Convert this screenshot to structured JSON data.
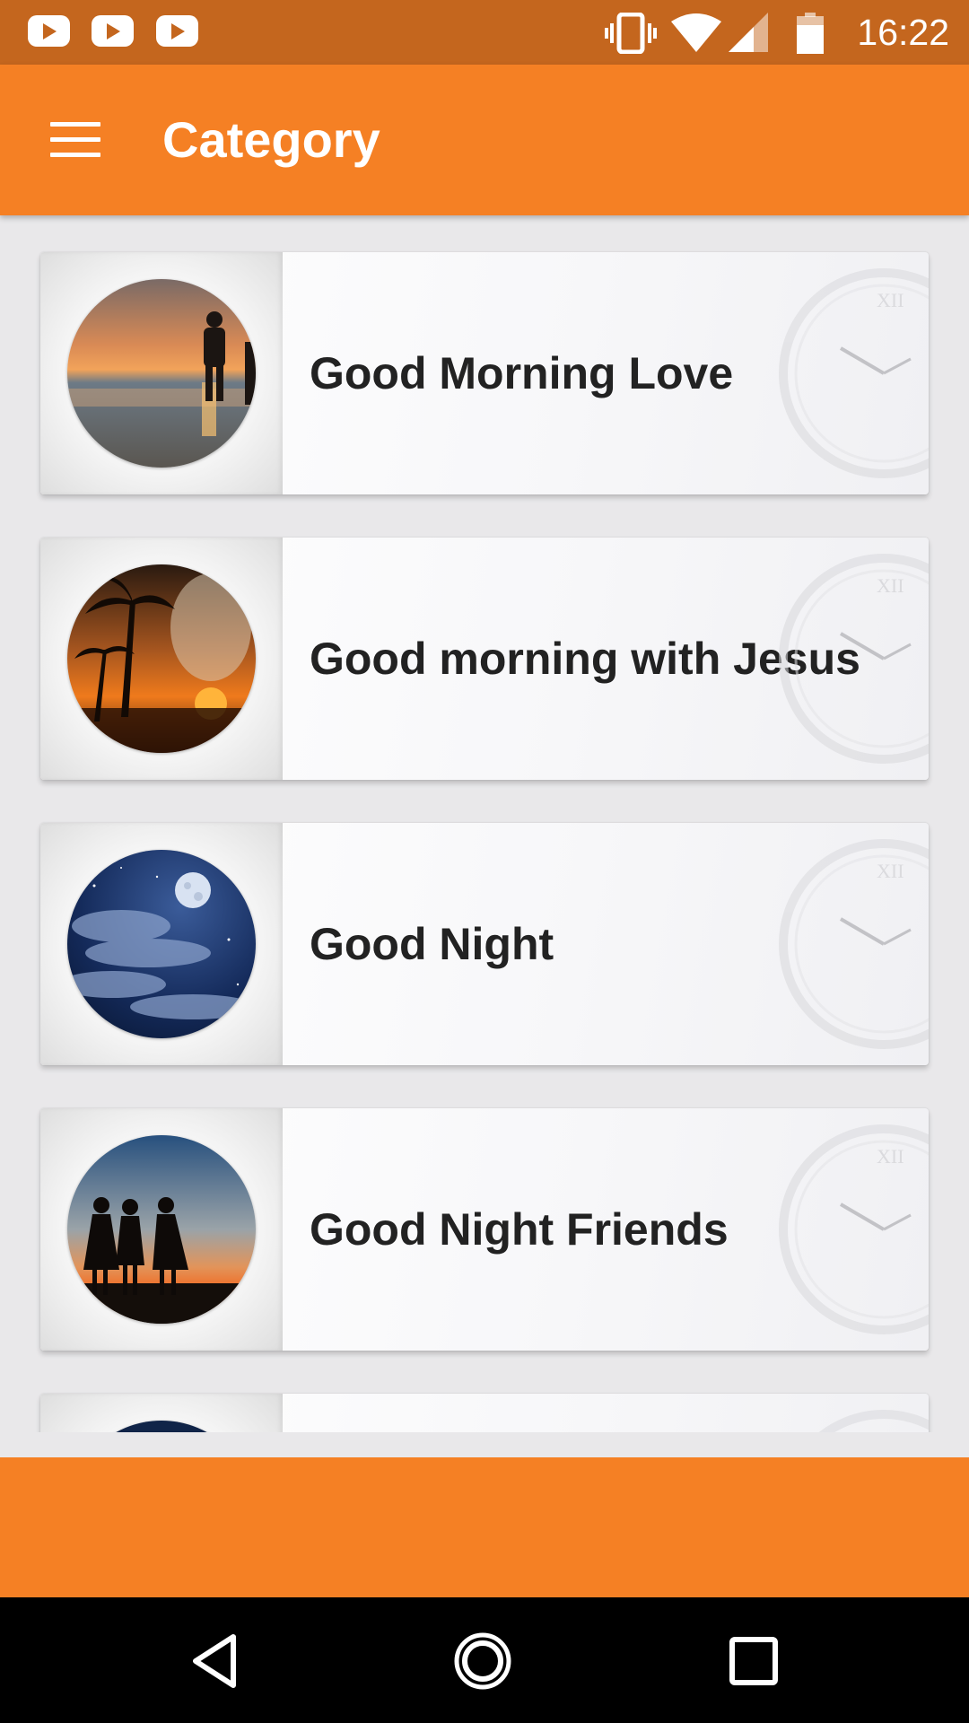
{
  "status_bar": {
    "time": "16:22",
    "notification_icons": [
      "youtube-icon",
      "youtube-icon",
      "youtube-icon"
    ],
    "system_icons": [
      "vibrate-icon",
      "wifi-icon",
      "signal-icon",
      "battery-icon"
    ]
  },
  "app_bar": {
    "menu_icon": "hamburger-menu-icon",
    "title": "Category"
  },
  "categories": [
    {
      "label": "Good Morning Love",
      "image": "couple-beach-sunset"
    },
    {
      "label": "Good morning with Jesus",
      "image": "palm-trees-sunset-jesus"
    },
    {
      "label": "Good Night",
      "image": "night-sky-moon-clouds"
    },
    {
      "label": "Good Night Friends",
      "image": "friends-silhouette-sunset"
    },
    {
      "label": "",
      "image": "night-sky-partial"
    }
  ],
  "nav_bar": {
    "back": "back-icon",
    "home": "home-icon",
    "recents": "recents-icon"
  },
  "colors": {
    "status_bar": "#c4661e",
    "app_bar": "#f58024",
    "background": "#e9e8ea",
    "text": "#222222"
  }
}
